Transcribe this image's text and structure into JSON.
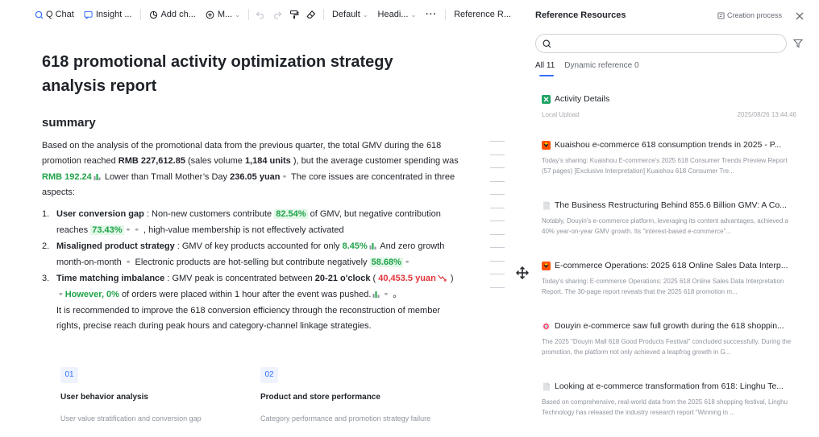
{
  "toolbar": {
    "q_chat": "Q Chat",
    "insight": "Insight ...",
    "add_chart": "Add ch...",
    "more": "M...",
    "style": "Default",
    "heading": "Headi...",
    "more_dots": "···",
    "reference": "Reference R..."
  },
  "document": {
    "title": "618 promotional activity optimization strategy analysis report",
    "summary_heading": "summary",
    "intro": {
      "p1": "Based on the analysis of the promotional data from the previous quarter, the total GMV during the 618 promotion reached ",
      "gmv": "RMB 227,612.85",
      "p2": " (sales volume ",
      "units": "1,184 units",
      "p3": " ), but the average customer spending was ",
      "spend": "RMB 192.24",
      "p4": " Lower than Tmall Mother’s Day ",
      "tmall": "236.05 yuan",
      "p5": " The core issues are concentrated in three aspects:"
    },
    "points": [
      {
        "num": "1.",
        "label": "User conversion gap",
        "a": " : Non-new customers contribute ",
        "v1": "82.54%",
        "b": "  of GMV, but negative contribution reaches ",
        "v2": "73.43%",
        "c": " , high-value membership is not effectively activated"
      },
      {
        "num": "2.",
        "label": "Misaligned product strategy",
        "a": " : GMV of key products accounted for only ",
        "v1": "8.45%",
        "b": " And zero growth month-on-month ",
        "c": " Electronic products are hot-selling but contribute negatively ",
        "v2": "58.68%"
      },
      {
        "num": "3.",
        "label": "Time matching imbalance",
        "a": " : GMV peak is concentrated between ",
        "time": "20-21 o'clock",
        "b": " ( ",
        "v1": "40,453.5 yuan",
        "c": " ) ",
        "v2": "However, 0%",
        "d": " of orders were placed within 1 hour after the event was pushed.",
        "e": " 。"
      }
    ],
    "closing": "It is recommended to improve the 618 conversion efficiency through the reconstruction of member rights, precise reach during peak hours and category-channel linkage strategies."
  },
  "cards": [
    {
      "num": "01",
      "title": "User behavior analysis",
      "subtitle": "User value stratification and conversion gap"
    },
    {
      "num": "02",
      "title": "Product and store performance",
      "subtitle": "Category performance and promotion strategy failure"
    }
  ],
  "panel": {
    "title": "Reference Resources",
    "creation": "Creation process",
    "search_placeholder": "",
    "tabs": [
      {
        "label": "All 11"
      },
      {
        "label": "Dynamic reference 0"
      }
    ],
    "items": [
      {
        "icon": "excel-icon",
        "title": "Activity Details",
        "source": "Local Upload",
        "date": "2025/08/26 13:44:46",
        "desc": ""
      },
      {
        "icon": "kuaishou-icon",
        "title": "Kuaishou e-commerce 618 consumption trends in 2025 - P...",
        "desc": "Today's sharing: Kuaishou E-commerce's 2025 618 Consumer Trends Preview Report (57 pages) [Exclusive Interpretation] Kuaishou 618 Consumer Tre..."
      },
      {
        "icon": "doc-icon",
        "title": "The Business Restructuring Behind 855.6 Billion GMV: A Co...",
        "desc": "Notably, Douyin's e-commerce platform, leveraging its content advantages, achieved a 40% year-on-year GMV growth. Its \"interest-based e-commerce\"..."
      },
      {
        "icon": "kuaishou-icon",
        "title": "E-commerce Operations: 2025 618 Online Sales Data Interp...",
        "desc": "Today's sharing: E-commerce Operations: 2025 618 Online Sales Data Interpretation Report. The 30-page report reveals that the 2025 618 promotion m..."
      },
      {
        "icon": "douyin-icon",
        "title": "Douyin e-commerce saw full growth during the 618 shoppin...",
        "desc": "The 2025 \"Douyin Mall 618 Good Products Festival\" concluded successfully. During the promotion, the platform not only achieved a leapfrog growth in G..."
      },
      {
        "icon": "doc-icon",
        "title": "Looking at e-commerce transformation from 618: Linghu Te...",
        "desc": "Based on comprehensive, real-world data from the 2025 618 shopping festival, Linghu Technology has released the industry research report \"Winning in ..."
      }
    ]
  },
  "colors": {
    "accent": "#3370ff",
    "green": "#1fa34a",
    "red": "#e0353b"
  }
}
